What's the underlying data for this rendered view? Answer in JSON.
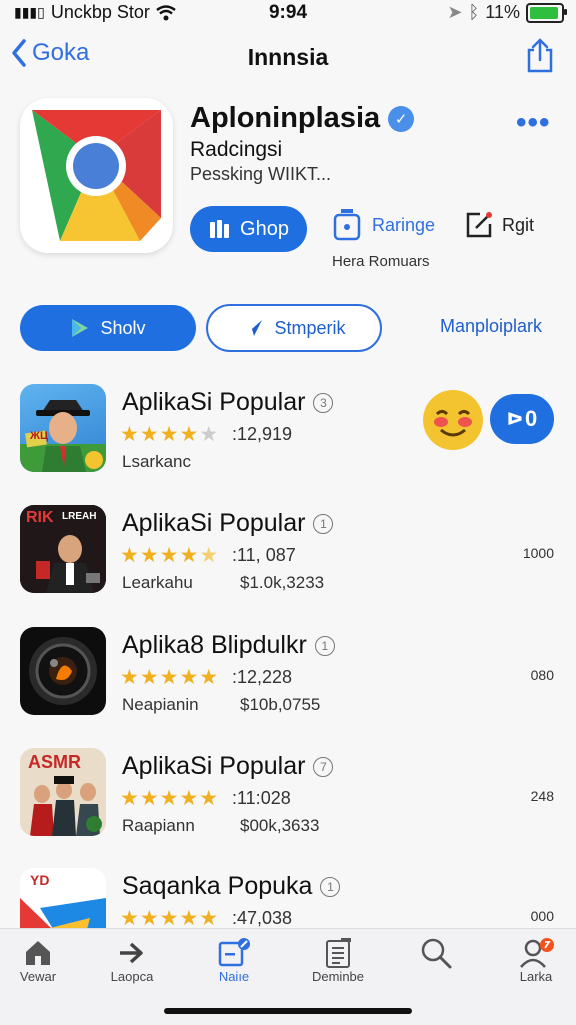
{
  "status": {
    "carrier": "Unckbp Stor",
    "time": "9:94",
    "battery_pct": "11%"
  },
  "nav": {
    "back_label": "Goka",
    "title": "Innnsia"
  },
  "app": {
    "name": "Aploninplasia",
    "subtitle": "Radcingsi",
    "subtitle2": "Pessking WIIKT...",
    "get_label": "Ghop",
    "action2_label": "Raringe",
    "action3_label": "Rgit",
    "caption": "Hera Romuars"
  },
  "pills": {
    "primary_label": "Sholv",
    "outline_label": "Stmperik",
    "link_label": "Manploiplark"
  },
  "badge_value": "0",
  "list": [
    {
      "title": "AplikaSi Popular",
      "info": "3",
      "rating": ":12,919",
      "meta": "Lsarkanc",
      "price": "",
      "right": "",
      "stars": 4
    },
    {
      "title": "AplikaSi Popular",
      "info": "1",
      "rating": ":11, 087",
      "meta": "Learkahu",
      "price": "$1.0k,3233",
      "right": "1000",
      "stars": 4.5
    },
    {
      "title": "Aplika8 Blipdulkr",
      "info": "1",
      "rating": ":12,228",
      "meta": "Neapianin",
      "price": "$10b,0755",
      "right": "080",
      "stars": 5
    },
    {
      "title": "AplikaSi Popular",
      "info": "7",
      "rating": ":11:028",
      "meta": "Raapiann",
      "price": "$00k,3633",
      "right": "248",
      "stars": 5
    },
    {
      "title": "Saqanka Popuka",
      "info": "1",
      "rating": ":47,038",
      "meta": "",
      "price": "",
      "right": "000",
      "stars": 5
    }
  ],
  "icon_texts": {
    "row1_badge": "ЖЦ",
    "row2_top": "RIK",
    "row2_side": "LREAH",
    "row4_top": "ASMR",
    "row5_top": "YD"
  },
  "tabs": [
    {
      "label": "Vewar",
      "icon": "home-icon"
    },
    {
      "label": "Laopca",
      "icon": "arrow-icon"
    },
    {
      "label": "Naiıe",
      "icon": "edit-icon"
    },
    {
      "label": "Deminbe",
      "icon": "list-icon"
    },
    {
      "label": "",
      "icon": "search-icon"
    },
    {
      "label": "Larka",
      "icon": "profile-icon"
    }
  ],
  "colors": {
    "accent": "#1f6fe0",
    "star": "#f0b020"
  }
}
